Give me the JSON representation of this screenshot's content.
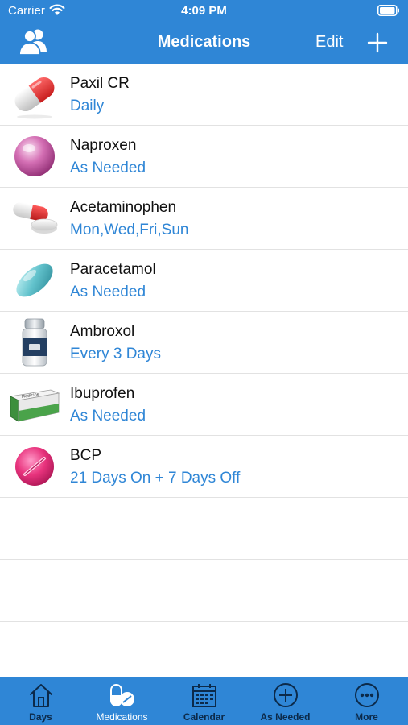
{
  "status": {
    "carrier": "Carrier",
    "time": "4:09 PM"
  },
  "nav": {
    "title": "Medications",
    "edit_label": "Edit"
  },
  "medications": [
    {
      "name": "Paxil CR",
      "schedule": "Daily",
      "icon": "capsule-icon"
    },
    {
      "name": "Naproxen",
      "schedule": "As Needed",
      "icon": "round-pill-icon"
    },
    {
      "name": "Acetaminophen",
      "schedule": "Mon,Wed,Fri,Sun",
      "icon": "capsule-and-tablet-icon"
    },
    {
      "name": "Paracetamol",
      "schedule": "As Needed",
      "icon": "oval-tablet-icon"
    },
    {
      "name": "Ambroxol",
      "schedule": "Every 3 Days",
      "icon": "pill-bottle-icon"
    },
    {
      "name": "Ibuprofen",
      "schedule": "As Needed",
      "icon": "medicine-box-icon"
    },
    {
      "name": "BCP",
      "schedule": "21 Days On + 7 Days Off",
      "icon": "scored-tablet-icon"
    }
  ],
  "medicine_box_text": "Medicine",
  "tabs": [
    {
      "label": "Days",
      "icon": "house-icon",
      "active": false
    },
    {
      "label": "Medications",
      "icon": "pills-icon",
      "active": true
    },
    {
      "label": "Calendar",
      "icon": "calendar-icon",
      "active": false
    },
    {
      "label": "As Needed",
      "icon": "plus-circle-icon",
      "active": false
    },
    {
      "label": "More",
      "icon": "more-icon",
      "active": false
    }
  ],
  "colors": {
    "accent": "#2f86d6",
    "tab_label": "#0c2a4a",
    "separator": "#e2e2e2"
  }
}
